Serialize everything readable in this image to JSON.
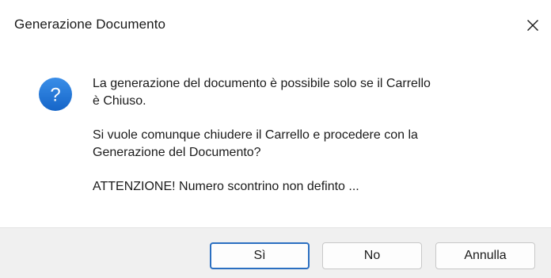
{
  "window": {
    "title": "Generazione Documento",
    "close_icon": "close-icon"
  },
  "message": {
    "icon": "question-icon",
    "icon_glyph": "?",
    "icon_color": "#1a73d9",
    "paragraph_1": "La generazione del documento è possibile solo  se il Carrello\nè Chiuso.",
    "paragraph_2": "Si vuole comunque chiudere il Carrello e procedere con la\nGenerazione del Documento?",
    "paragraph_3": "ATTENZIONE! Numero scontrino non definto ..."
  },
  "buttons": {
    "yes_label": "Sì",
    "no_label": "No",
    "cancel_label": "Annulla",
    "default_button": "yes"
  },
  "colors": {
    "accent": "#2b6fc1",
    "footer_bg": "#f0f0f0"
  }
}
